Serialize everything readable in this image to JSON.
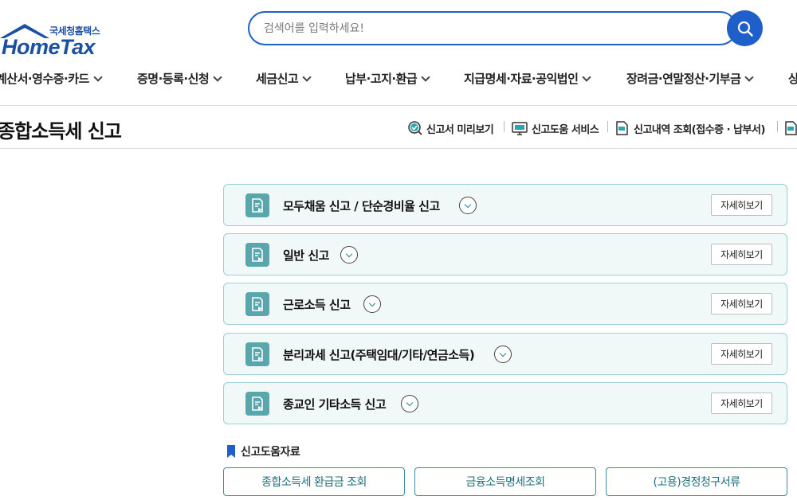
{
  "logo": {
    "sub": "국세청홈택스",
    "main": "HomeTax"
  },
  "search": {
    "placeholder": "검색어를 입력하세요!",
    "button_icon": "search-icon"
  },
  "gnb": [
    {
      "label": "계산서·영수증·카드"
    },
    {
      "label": "증명·등록·신청"
    },
    {
      "label": "세금신고"
    },
    {
      "label": "납부·고지·환급"
    },
    {
      "label": "지급명세·자료·공익법인"
    },
    {
      "label": "장려금·연말정산·기부금"
    },
    {
      "label": "상"
    }
  ],
  "page_title": "종합소득세 신고",
  "quick_links": [
    {
      "label": "신고서 미리보기",
      "icon": "preview-check-icon"
    },
    {
      "label": "신고도움 서비스",
      "icon": "monitor-help-icon"
    },
    {
      "label": "신고내역 조회(접수증 · 납부서)",
      "icon": "document-search-icon"
    },
    {
      "label": "",
      "icon": "document-edit-icon"
    }
  ],
  "accordion": [
    {
      "label": "모두채움 신고 / 단순경비율 신고",
      "button": "자세히보기"
    },
    {
      "label": "일반 신고",
      "button": "자세히보기"
    },
    {
      "label": "근로소득 신고",
      "button": "자세히보기"
    },
    {
      "label": "분리과세 신고(주택임대/기타/연금소득)",
      "button": "자세히보기"
    },
    {
      "label": "종교인 기타소득 신고",
      "button": "자세히보기"
    }
  ],
  "reference": {
    "title": "신고도움자료",
    "buttons": [
      "종합소득세 환급금 조회",
      "금융소득명세조회",
      "(고용)경정청구서류"
    ]
  },
  "colors": {
    "brand": "#1f5fc9",
    "teal": "#5aa6ad",
    "teal_border": "#9ccfd6",
    "panel_bg": "#f0f8f8"
  }
}
